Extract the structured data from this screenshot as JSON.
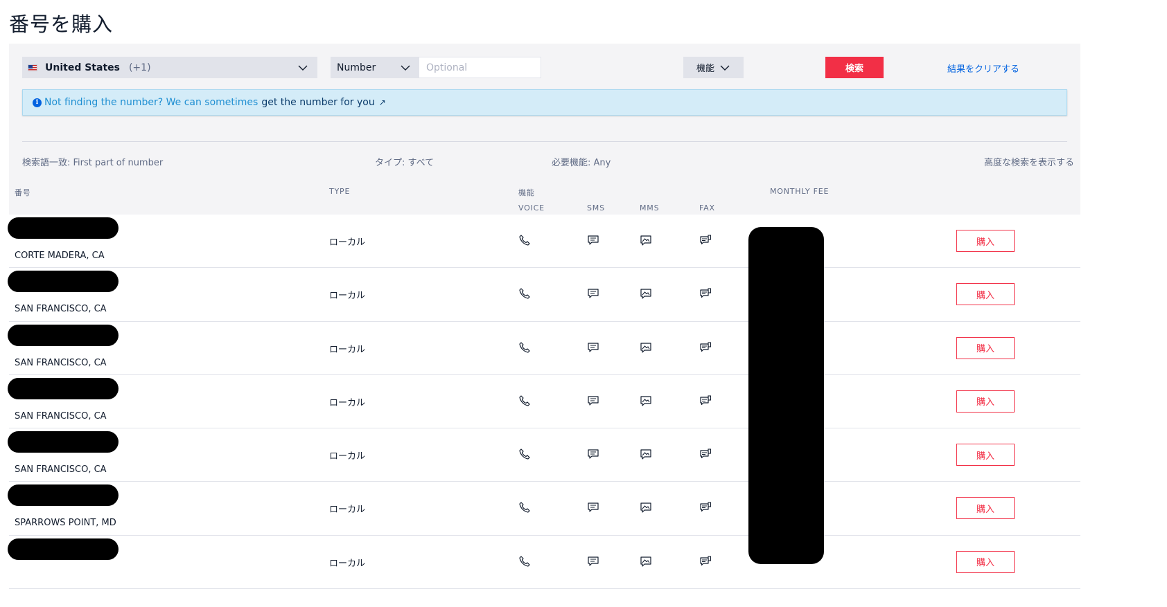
{
  "page_title": "番号を購入",
  "search": {
    "country_name": "United States",
    "country_code": "(+1)",
    "type_value": "Number",
    "number_placeholder": "Optional",
    "capability_label": "機能",
    "search_button": "検索",
    "clear_link": "結果をクリアする"
  },
  "banner": {
    "icon": "i",
    "text": "Not finding the number? We can sometimes",
    "link": "get the number for you",
    "external_icon": "↗"
  },
  "filters": {
    "match": "検索語一致: First part of number",
    "type": "タイプ: すべて",
    "capabilities": "必要機能: Any",
    "advanced_link": "高度な検索を表示する"
  },
  "columns": {
    "number": "番号",
    "type": "TYPE",
    "capabilities": "機能",
    "voice": "VOICE",
    "sms": "SMS",
    "mms": "MMS",
    "fax": "FAX",
    "monthly_fee": "MONTHLY FEE"
  },
  "rows": [
    {
      "location": "CORTE MADERA, CA",
      "type": "ローカル",
      "buy": "購入"
    },
    {
      "location": "SAN FRANCISCO, CA",
      "type": "ローカル",
      "buy": "購入"
    },
    {
      "location": "SAN FRANCISCO, CA",
      "type": "ローカル",
      "buy": "購入"
    },
    {
      "location": "SAN FRANCISCO, CA",
      "type": "ローカル",
      "buy": "購入"
    },
    {
      "location": "SAN FRANCISCO, CA",
      "type": "ローカル",
      "buy": "購入"
    },
    {
      "location": "SPARROWS POINT, MD",
      "type": "ローカル",
      "buy": "購入"
    },
    {
      "location": "",
      "type": "ローカル",
      "buy": "購入"
    }
  ],
  "icons": {
    "voice": "phone-icon",
    "sms": "sms-icon",
    "mms": "mms-icon",
    "fax": "fax-icon",
    "flag": "us-flag-icon"
  },
  "colors": {
    "accent_red": "#f22f46",
    "link_blue": "#0263e0",
    "banner_bg": "#d4ecf8"
  }
}
